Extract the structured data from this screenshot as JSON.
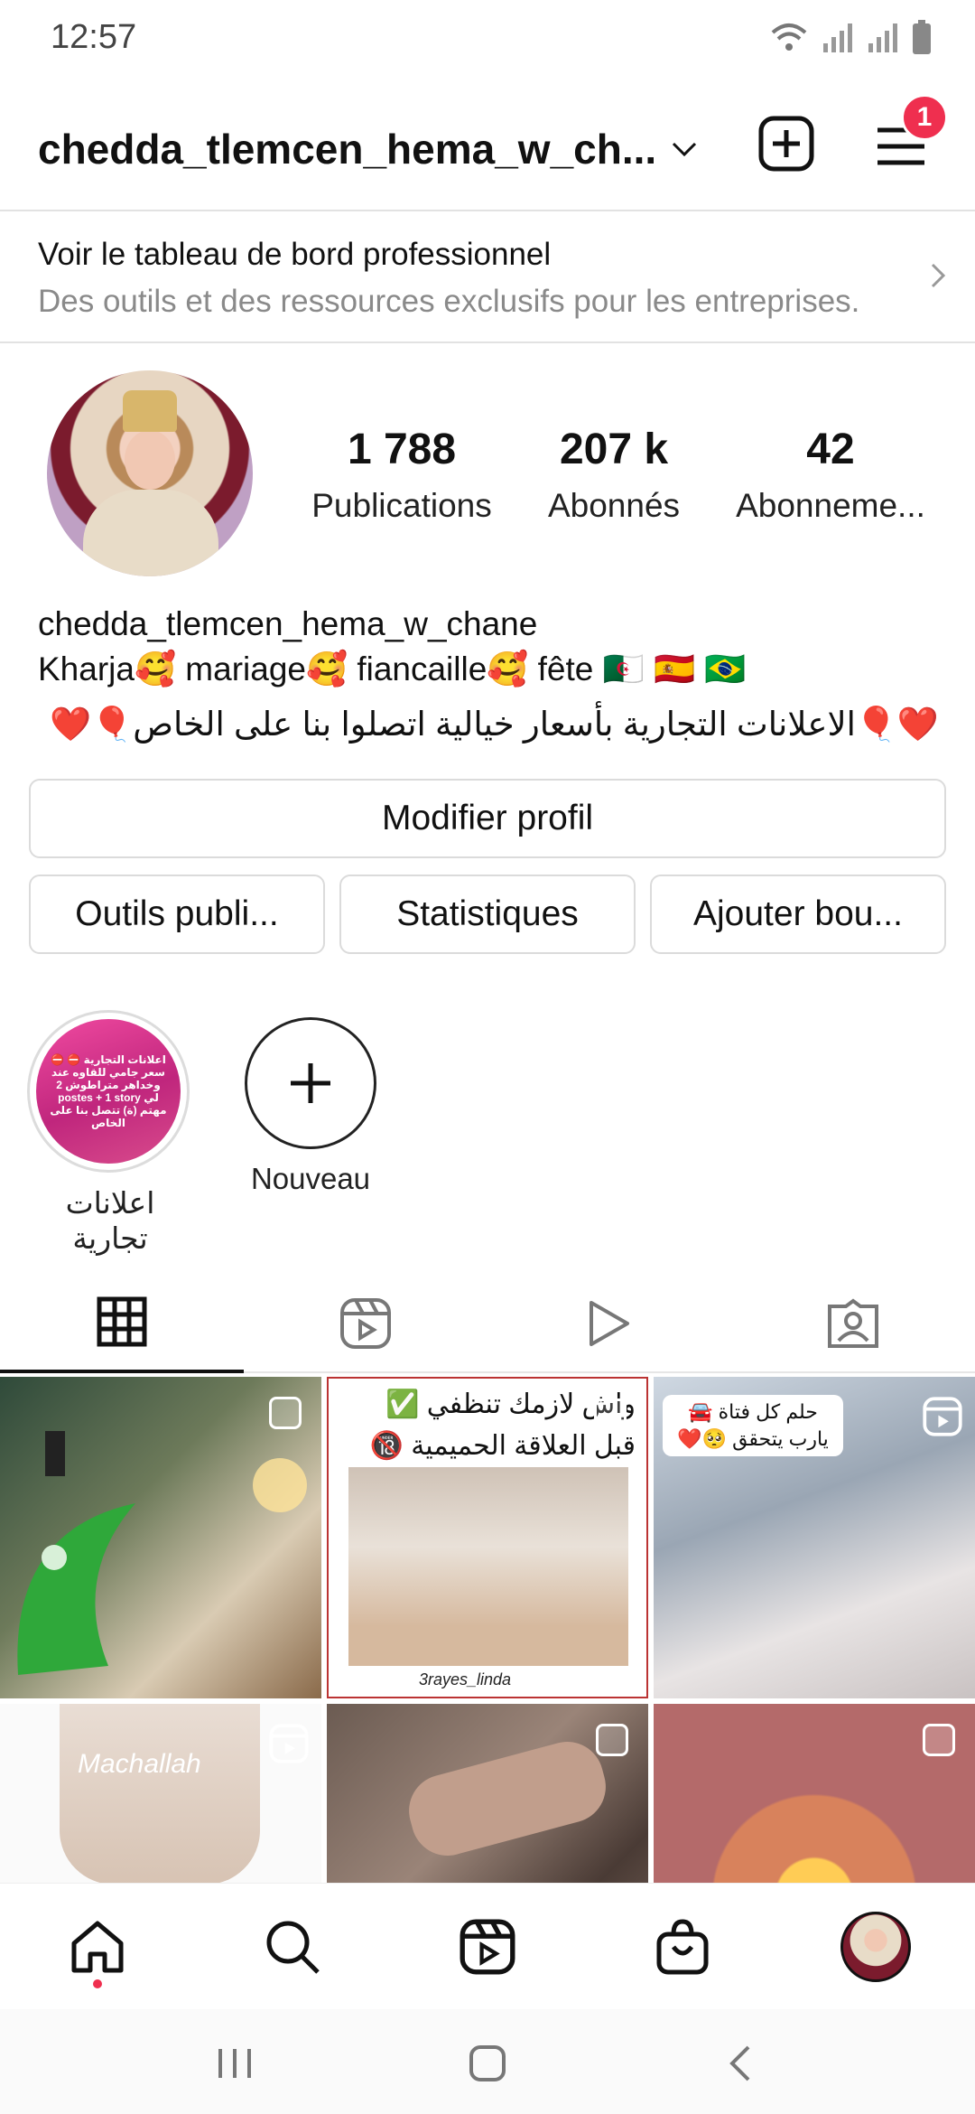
{
  "status_bar": {
    "time": "12:57"
  },
  "header": {
    "username": "chedda_tlemcen_hema_w_ch...",
    "notification_count": "1"
  },
  "pro_banner": {
    "title": "Voir le tableau de bord professionnel",
    "subtitle": "Des outils et des ressources exclusifs pour les entreprises."
  },
  "stats": {
    "posts": {
      "value": "1 788",
      "label": "Publications"
    },
    "followers": {
      "value": "207 k",
      "label": "Abonnés"
    },
    "following": {
      "value": "42",
      "label": "Abonneme..."
    }
  },
  "bio": {
    "name": "chedda_tlemcen_hema_w_chane",
    "line1": "Kharja🥰 mariage🥰 fiancaille🥰 fête 🇩🇿 🇪🇸 🇧🇷",
    "line2": "❤️🎈الاعلانات التجارية بأسعار خيالية اتصلوا بنا على الخاص🎈❤️"
  },
  "buttons": {
    "edit_profile": "Modifier profil",
    "pro_tools": "Outils publi...",
    "insights": "Statistiques",
    "add_button": "Ajouter bou..."
  },
  "highlights": [
    {
      "label": "اعلانات تجارية",
      "cover_text": "⛔ اعلانات التجارية ⛔ سعر جامي للقاوه عند وخداهر متراطوش 2 postes + 1 story لي مهتم (ة) تتصل بنا على الخاص"
    },
    {
      "label": "Nouveau"
    }
  ],
  "grid": [
    {
      "overlay_text": ""
    },
    {
      "overlay_text": "واش لازمك تنظفي ✅ قبل العلاقة الحميمية 🔞",
      "footer": "3rayes_linda"
    },
    {
      "overlay_text": "حلم كل فتاة 🚘 يارب يتحقق 🥺❤️"
    },
    {
      "overlay_text": "Machallah"
    },
    {
      "overlay_text": ""
    },
    {
      "overlay_text": ""
    }
  ],
  "colors": {
    "badge": "#ef2f4f",
    "text": "#111111",
    "muted": "#8a8a8a",
    "border": "#dbdbdb"
  },
  "icons": [
    "wifi-icon",
    "signal-icon",
    "battery-icon",
    "chevron-down-icon",
    "add-post-icon",
    "menu-icon",
    "chevron-right-icon",
    "plus-icon",
    "grid-icon",
    "reels-icon",
    "video-icon",
    "tagged-icon",
    "home-icon",
    "search-icon",
    "shop-icon",
    "recent-apps-icon",
    "home-button-icon",
    "back-icon"
  ]
}
